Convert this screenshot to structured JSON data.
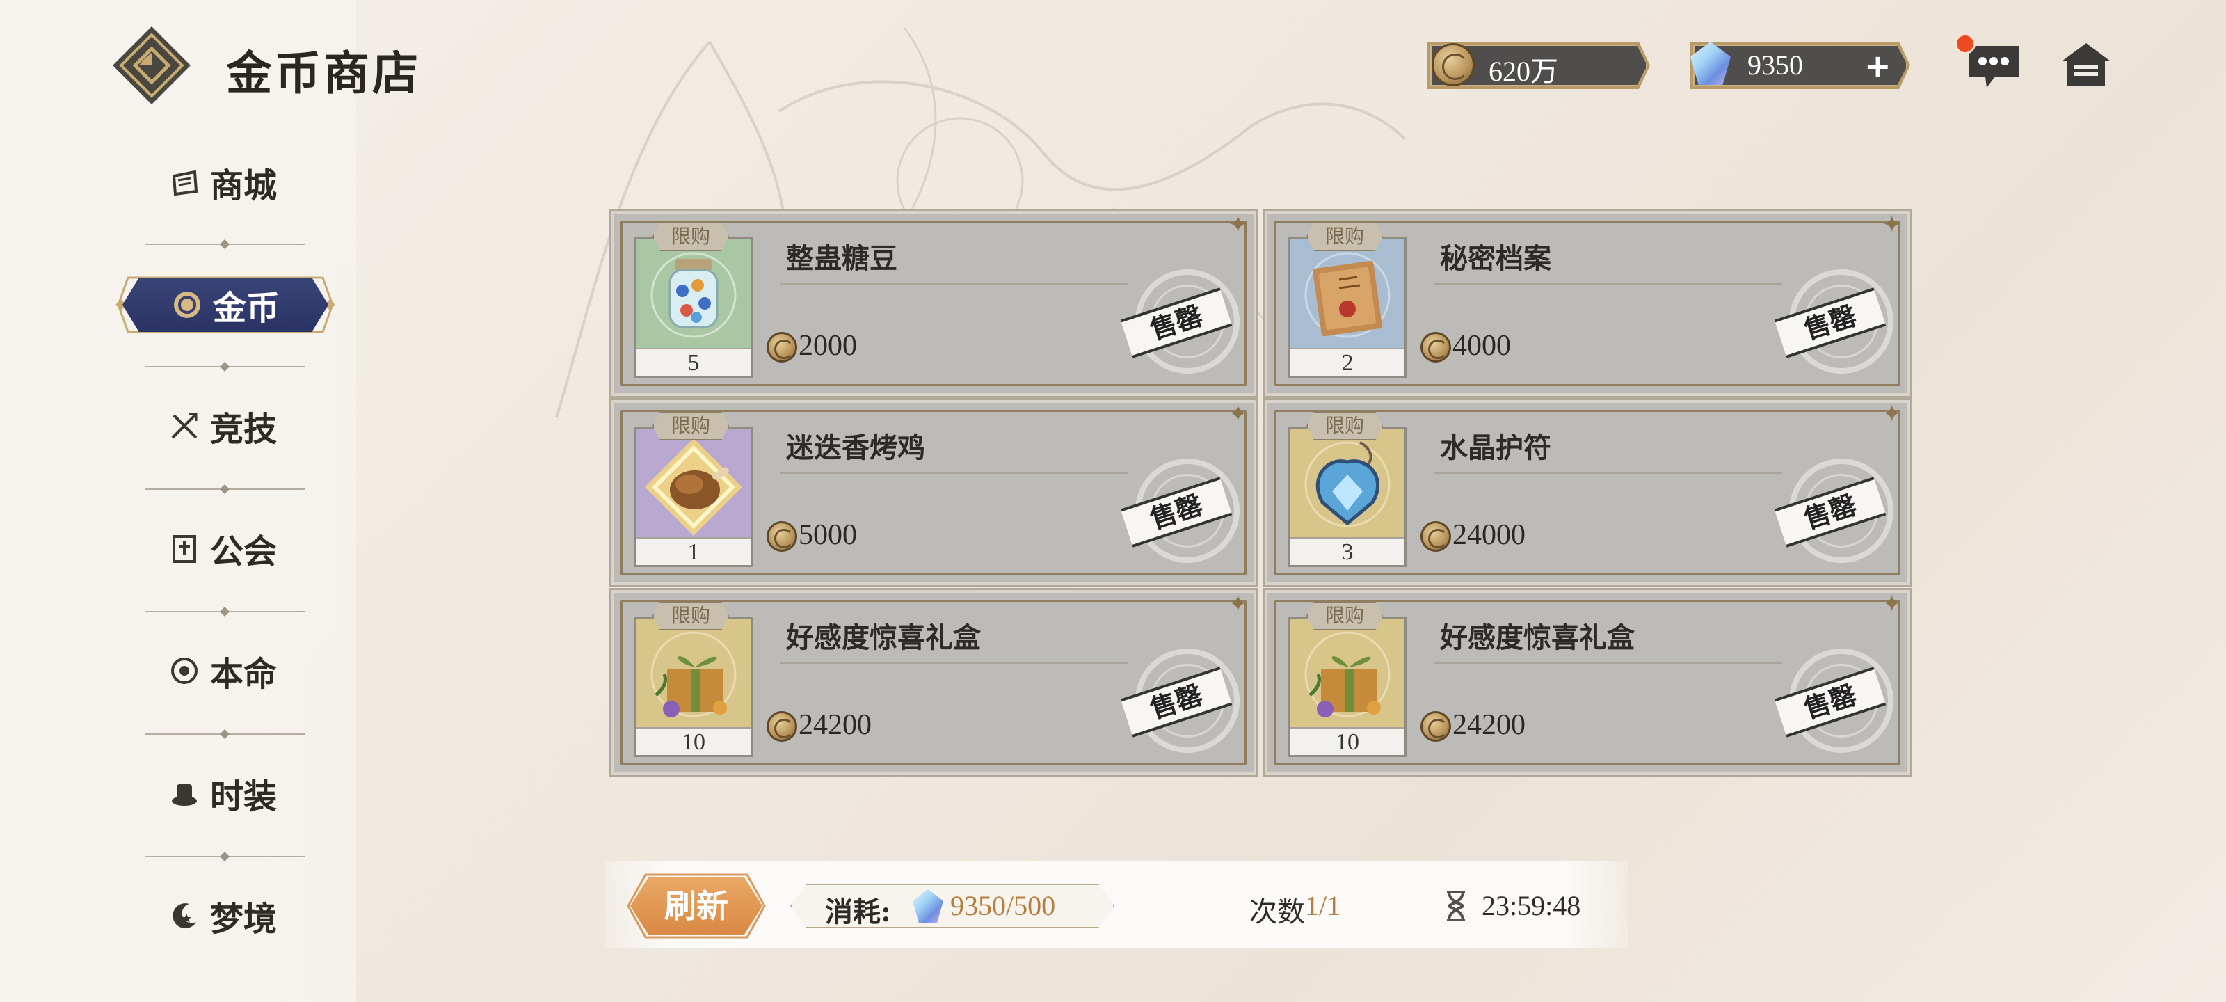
{
  "header": {
    "title": "金币商店",
    "gold_amount": "620万",
    "gem_amount": "9350",
    "plus_label": "+"
  },
  "sidebar": {
    "items": [
      {
        "label": "商城",
        "icon": "mall-icon",
        "active": false
      },
      {
        "label": "金币",
        "icon": "coin-icon",
        "active": true
      },
      {
        "label": "竞技",
        "icon": "crossed-swords-icon",
        "active": false
      },
      {
        "label": "公会",
        "icon": "guild-banner-icon",
        "active": false
      },
      {
        "label": "本命",
        "icon": "emblem-icon",
        "active": false
      },
      {
        "label": "时装",
        "icon": "hat-icon",
        "active": false
      },
      {
        "label": "梦境",
        "icon": "moon-star-icon",
        "active": false
      }
    ]
  },
  "shop": {
    "limit_label": "限购",
    "sold_label": "售罄",
    "items": [
      {
        "name": "整蛊糖豆",
        "quantity": "5",
        "price": "2000",
        "thumb_color": "#a9c7a3",
        "art": "candy-jar-icon"
      },
      {
        "name": "秘密档案",
        "quantity": "2",
        "price": "4000",
        "thumb_color": "#a9bdd2",
        "art": "secret-file-icon"
      },
      {
        "name": "迷迭香烤鸡",
        "quantity": "1",
        "price": "5000",
        "thumb_color": "#b9a9d0",
        "art": "roast-chicken-icon"
      },
      {
        "name": "水晶护符",
        "quantity": "3",
        "price": "24000",
        "thumb_color": "#d8c58a",
        "art": "crystal-amulet-icon"
      },
      {
        "name": "好感度惊喜礼盒",
        "quantity": "10",
        "price": "24200",
        "thumb_color": "#d8c58a",
        "art": "gift-box-icon"
      },
      {
        "name": "好感度惊喜礼盒",
        "quantity": "10",
        "price": "24200",
        "thumb_color": "#d8c58a",
        "art": "gift-box-icon"
      }
    ]
  },
  "bottom": {
    "refresh_label": "刷新",
    "cost_label": "消耗:",
    "cost_value": "9350/500",
    "count_label": "次数",
    "count_value": "1/1",
    "timer": "23:59:48"
  },
  "colors": {
    "accent_gold": "#b57d3f",
    "active_tab": "#2f3868",
    "refresh_orange": "#e29a55"
  }
}
